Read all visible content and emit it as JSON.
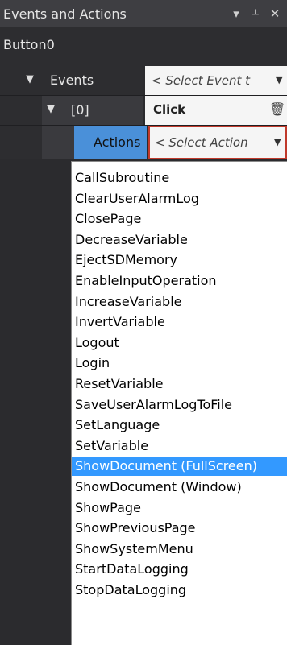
{
  "panel": {
    "title": "Events and Actions",
    "pin_icon": "pin-icon",
    "close_icon": "close-icon",
    "dropdown_icon": "dropdown-arrow-icon"
  },
  "object_name": "Button0",
  "grid": {
    "events_label": "Events",
    "events_value": "< Select Event t",
    "item_index": "[0]",
    "item_value": "Click",
    "actions_label": "Actions",
    "actions_value": "< Select Action"
  },
  "dropdown": {
    "items": [
      "CallSubroutine",
      "ClearUserAlarmLog",
      "ClosePage",
      "DecreaseVariable",
      "EjectSDMemory",
      "EnableInputOperation",
      "IncreaseVariable",
      "InvertVariable",
      "Logout",
      "Login",
      "ResetVariable",
      "SaveUserAlarmLogToFile",
      "SetLanguage",
      "SetVariable",
      "ShowDocument (FullScreen)",
      "ShowDocument (Window)",
      "ShowPage",
      "ShowPreviousPage",
      "ShowSystemMenu",
      "StartDataLogging",
      "StopDataLogging"
    ],
    "selected": "ShowDocument (FullScreen)"
  },
  "colors": {
    "selection": "#3399ff",
    "focus_border": "#c0392b"
  }
}
